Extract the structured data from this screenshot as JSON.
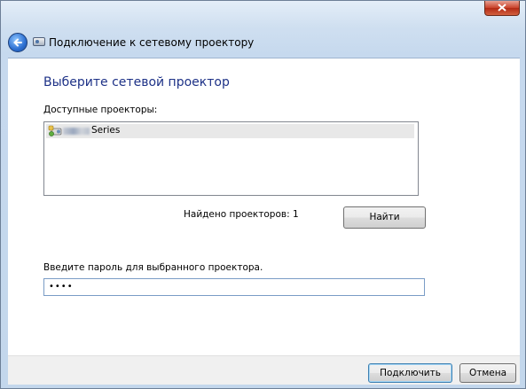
{
  "window": {
    "title": "Подключение к сетевому проектору"
  },
  "main": {
    "heading": "Выберите сетевой проектор",
    "available_label": "Доступные проекторы:",
    "projectors": [
      {
        "name": "Series",
        "selected": true
      }
    ],
    "found_count_text": "Найдено проекторов: 1",
    "find_button": "Найти",
    "password_label": "Введите пароль для выбранного проектора.",
    "password_value": "••••"
  },
  "footer": {
    "connect_button": "Подключить",
    "cancel_button": "Отмена"
  },
  "colors": {
    "heading": "#1e3287",
    "frame": "#c6d9ee",
    "close": "#c9412a"
  }
}
